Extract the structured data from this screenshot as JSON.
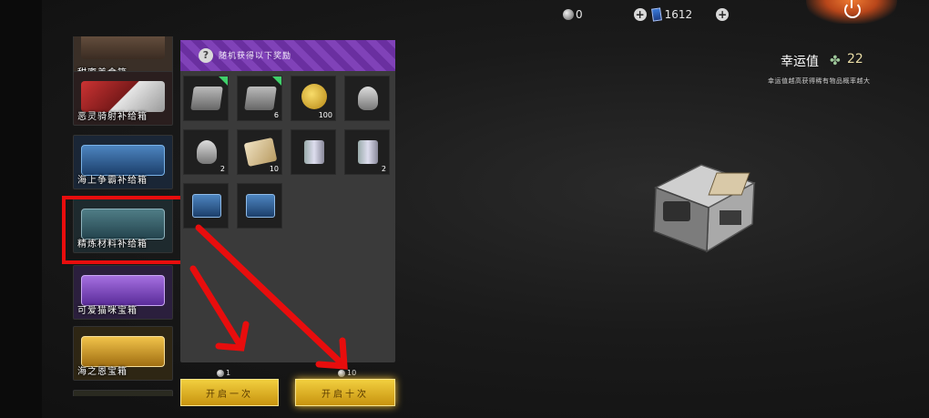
{
  "topbar": {
    "coin_amount": "0",
    "ticket_amount": "1612"
  },
  "crate_list": [
    {
      "label": "甜蜜美食箱",
      "art_color": "#4b3a2c"
    },
    {
      "label": "恶灵骑射补给箱",
      "art_color": "#6d2020"
    },
    {
      "label": "海上争霸补给箱",
      "art_color": "#2b5a8a"
    },
    {
      "label": "精炼材料补给箱",
      "art_color": "#365a6b"
    },
    {
      "label": "可爱猫咪宝箱",
      "art_color": "#6b3da8"
    },
    {
      "label": "海之恩宝箱",
      "art_color": "#c28d1c"
    }
  ],
  "reward_panel": {
    "help_symbol": "?",
    "title": "随机获得以下奖励",
    "items": [
      {
        "name": "small-crate-gray-item",
        "count": "",
        "new": true
      },
      {
        "name": "small-crate-gray-item",
        "count": "6",
        "new": true
      },
      {
        "name": "gold-coins-item",
        "count": "100",
        "new": false
      },
      {
        "name": "dog-tag-item",
        "count": "",
        "new": false
      },
      {
        "name": "eye-tag-item",
        "count": "2",
        "new": false
      },
      {
        "name": "scroll-ticket-item",
        "count": "10",
        "new": false
      },
      {
        "name": "silver-can-item",
        "count": "",
        "new": false
      },
      {
        "name": "silver-can-item",
        "count": "2",
        "new": false
      },
      {
        "name": "blue-crate-item",
        "count": "",
        "new": false
      },
      {
        "name": "blue-crate-item",
        "count": "",
        "new": false
      }
    ]
  },
  "open_once": {
    "cost": "1",
    "label": "开启一次"
  },
  "open_ten": {
    "cost": "10",
    "label": "开启十次"
  },
  "luck": {
    "title": "幸运值",
    "value": "22",
    "description": "幸运值越高获得稀有物品概率越大"
  },
  "colors": {
    "panel_header": "#7a3bb0",
    "button_gold": "#e2b32a",
    "annotation_red": "#e80d0d",
    "new_flag": "#3fd06a"
  }
}
